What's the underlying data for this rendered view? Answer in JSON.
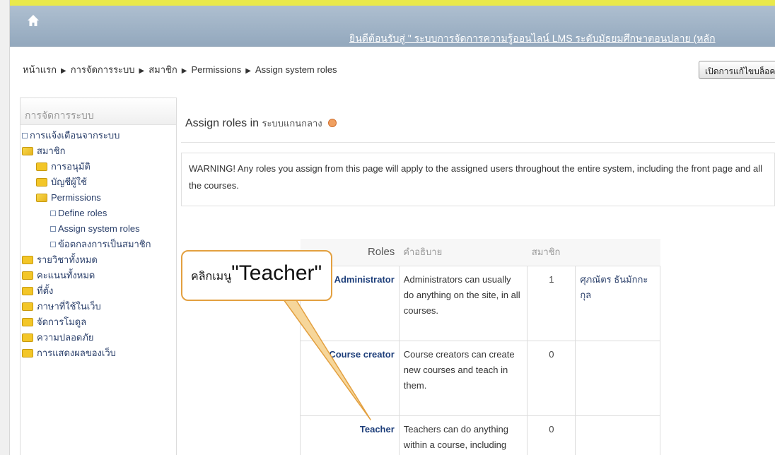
{
  "header": {
    "site_title": "ยินดีต้อนรับสู่ \" ระบบการจัดการความรู้ออนไลน์ LMS ระดับมัธยมศึกษาตอนปลาย (หลัก",
    "accent_color": "#e9e94a",
    "bar_color": "#a3b6c9"
  },
  "breadcrumb": [
    "หน้าแรก",
    "การจัดการระบบ",
    "สมาชิก",
    "Permissions",
    "Assign system roles"
  ],
  "breadcrumb_separator": "▶",
  "edit_button_label": "เปิดการแก้ไขบล็อค",
  "sidebar": {
    "title": "การจัดการระบบ",
    "items": [
      {
        "label": "การแจ้งเตือนจากระบบ",
        "level": 0,
        "icon": "bullet-icon"
      },
      {
        "label": "สมาชิก",
        "level": 0,
        "icon": "folder-open-icon"
      },
      {
        "label": "การอนุมัติ",
        "level": 1,
        "icon": "folder-icon"
      },
      {
        "label": "บัญชีผู้ใช้",
        "level": 1,
        "icon": "folder-icon"
      },
      {
        "label": "Permissions",
        "level": 1,
        "icon": "folder-open-icon"
      },
      {
        "label": "Define roles",
        "level": 2,
        "icon": "bullet-icon"
      },
      {
        "label": "Assign system roles",
        "level": 2,
        "icon": "bullet-icon"
      },
      {
        "label": "ข้อตกลงการเป็นสมาชิก",
        "level": 2,
        "icon": "bullet-icon"
      },
      {
        "label": "รายวิชาทั้งหมด",
        "level": 0,
        "icon": "folder-icon"
      },
      {
        "label": "คะแนนทั้งหมด",
        "level": 0,
        "icon": "folder-icon"
      },
      {
        "label": "ที่ตั้ง",
        "level": 0,
        "icon": "folder-icon"
      },
      {
        "label": "ภาษาที่ใช้ในเว็บ",
        "level": 0,
        "icon": "folder-icon"
      },
      {
        "label": "จัดการโมดูล",
        "level": 0,
        "icon": "folder-icon"
      },
      {
        "label": "ความปลอดภัย",
        "level": 0,
        "icon": "folder-icon"
      },
      {
        "label": "การแสดงผลของเว็บ",
        "level": 0,
        "icon": "folder-icon"
      }
    ]
  },
  "main": {
    "title": "Assign roles in",
    "context": "ระบบแกนกลาง",
    "warning": "WARNING! Any roles you assign from this page will apply to the assigned users throughout the entire system, including the front page and all the courses.",
    "table": {
      "headers": [
        "Roles",
        "คำอธิบาย",
        "สมาชิก",
        ""
      ],
      "rows": [
        {
          "role": "Administrator",
          "description": "Administrators can usually do anything on the site, in all courses.",
          "count": "1",
          "users": "ศุภณัตร ธันมักกะกุล"
        },
        {
          "role": "Course creator",
          "description": "Course creators can create new courses and teach in them.",
          "count": "0",
          "users": ""
        },
        {
          "role": "Teacher",
          "description": "Teachers can do anything within a course, including",
          "count": "0",
          "users": ""
        }
      ]
    }
  },
  "callout": {
    "prefix": "คลิกเมนู",
    "target": "\"Teacher\"",
    "border_color": "#e3a040"
  }
}
